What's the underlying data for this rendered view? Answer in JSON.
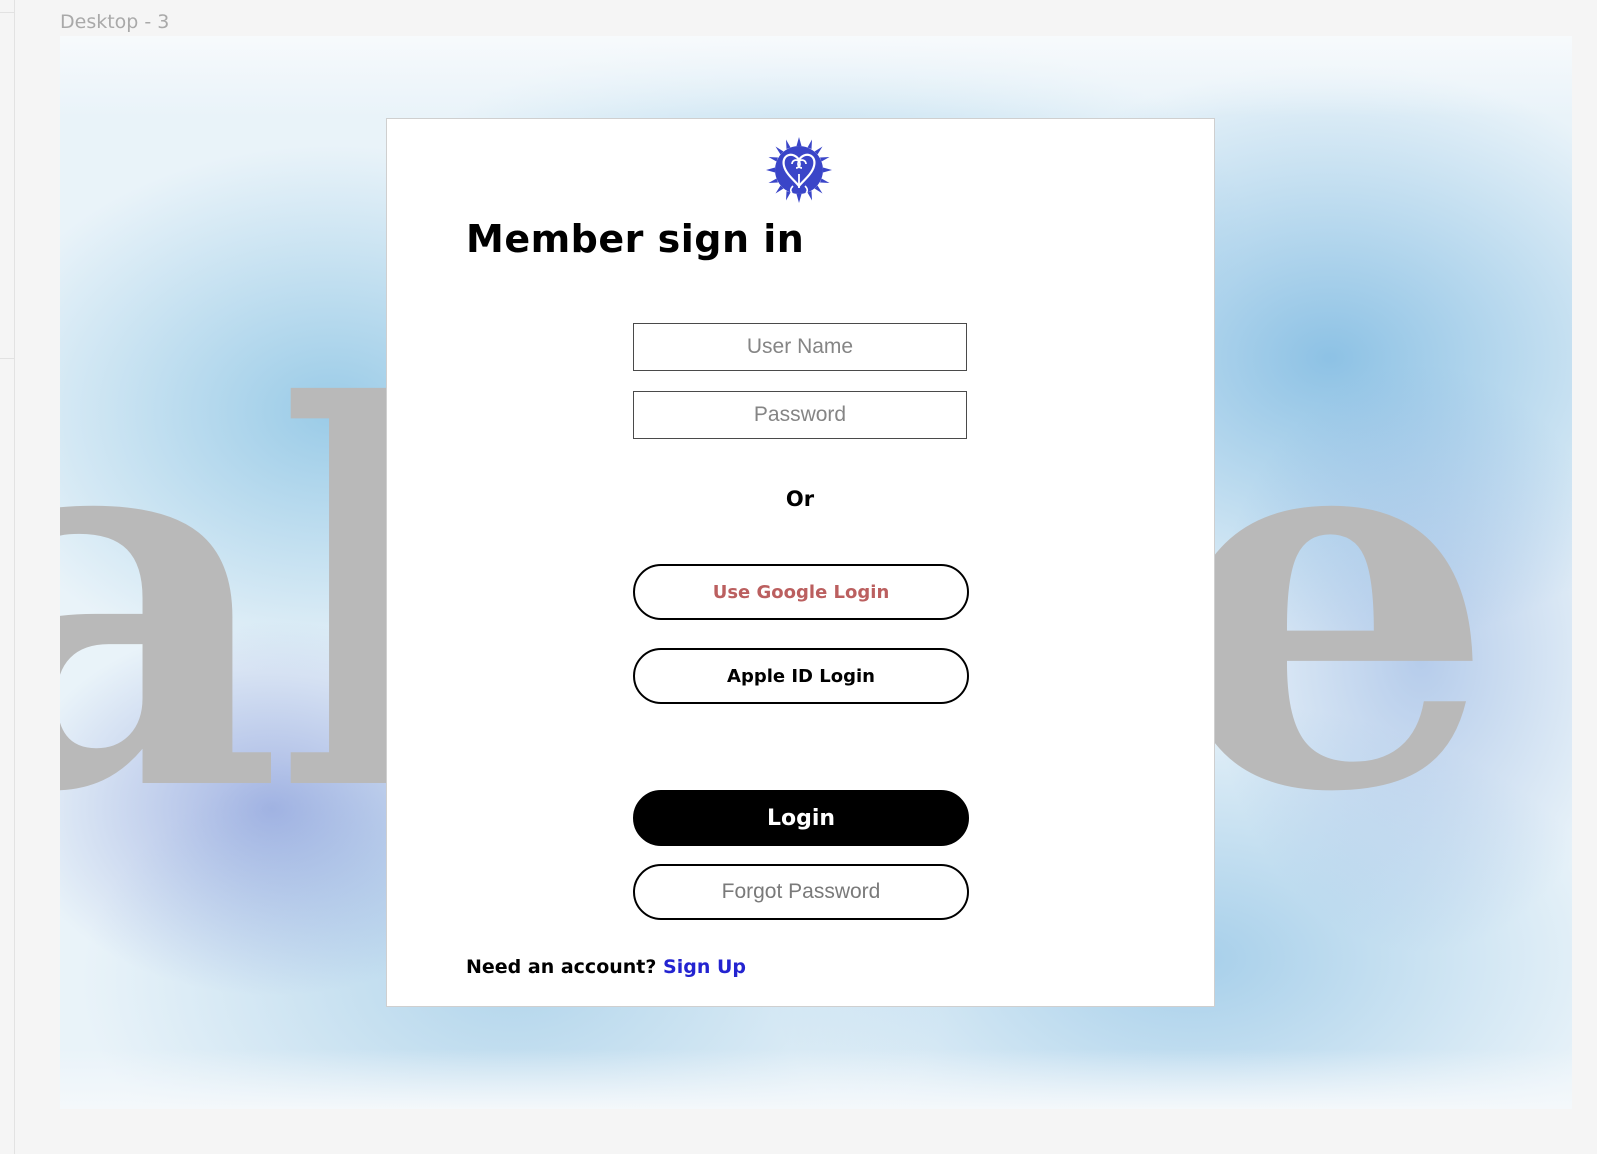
{
  "canvas": {
    "frame_label": "Desktop - 3"
  },
  "background": {
    "word": "alone"
  },
  "signin": {
    "title": "Member sign in",
    "username_placeholder": "User Name",
    "password_placeholder": "Password",
    "or_label": "Or",
    "google_label": "Use Google Login",
    "apple_label": "Apple ID Login",
    "login_label": "Login",
    "forgot_label": "Forgot Password",
    "need_account": "Need an account?",
    "signup_label": "Sign Up"
  },
  "icons": {
    "logo": "sankofa-heart-sun-icon"
  },
  "colors": {
    "accent_blue": "#2323d0",
    "google_red": "#bb5f5f",
    "logo_blue": "#3a45c8",
    "login_bg": "#000000",
    "bg_word": "#b9b9b9"
  }
}
